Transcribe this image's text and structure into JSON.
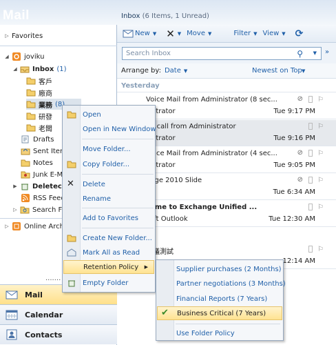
{
  "nav": {
    "title": "Mail",
    "favorites": "Favorites",
    "account": "joviku",
    "inbox": {
      "label": "Inbox",
      "count": "(1)"
    },
    "subfolders": [
      "客戶",
      "廠商",
      "業務",
      "研發",
      "老闆"
    ],
    "subfolder_count": "(8)",
    "drafts": "Drafts",
    "sent": "Sent Iter",
    "notes": "Notes",
    "junk": "Junk E-M",
    "deleted": "Deletec",
    "rss": "RSS Feed",
    "searchf": "Search F",
    "archive": "Online Arch",
    "dots": ".......",
    "buttons": [
      "Mail",
      "Calendar",
      "Contacts"
    ]
  },
  "main": {
    "folder": "Inbox",
    "folder_count": "(6 Items,  1 Unread)",
    "toolbar": {
      "new": "New",
      "move": "Move",
      "filter": "Filter",
      "view": "View"
    },
    "search_placeholder": "Search Inbox",
    "arrange_by": "Arrange by:",
    "arrange_value": "Date",
    "sort_order": "Newest on Top",
    "group": "Yesterday",
    "messages": [
      {
        "subject": "Voice Mail from Administrator (8 sec...",
        "from": "nistrator",
        "time": "Tue 9:17 PM"
      },
      {
        "subject": "ed call from Administrator",
        "from": "nistrator",
        "time": "Tue 9:16 PM"
      },
      {
        "subject": "Voice Mail from Administrator (4 sec...",
        "from": "nistrator",
        "time": "Tue 9:05 PM"
      },
      {
        "subject": "ange 2010 Slide",
        "from": "u",
        "time": "Tue 6:34 AM"
      },
      {
        "subject": "come to Exchange Unified ...",
        "from": "soft Outlook",
        "time": "Tue 12:30 AM"
      },
      {
        "subject": "會議測試",
        "from": "",
        "time": "12:14 AM"
      }
    ]
  },
  "context_menu": {
    "items": [
      "Open",
      "Open in New Window",
      "Move Folder...",
      "Copy Folder...",
      "Delete",
      "Rename",
      "Add to Favorites",
      "Create New Folder...",
      "Mark All as Read",
      "Retention Policy",
      "Empty Folder"
    ]
  },
  "retention_menu": {
    "items": [
      "Supplier purchases (2 Months)",
      "Partner negotiations (3 Months)",
      "Financial Reports (7 Years)",
      "Business Critical (7 Years)",
      "Use Folder Policy"
    ],
    "checked": "Business Critical (7 Years)"
  }
}
